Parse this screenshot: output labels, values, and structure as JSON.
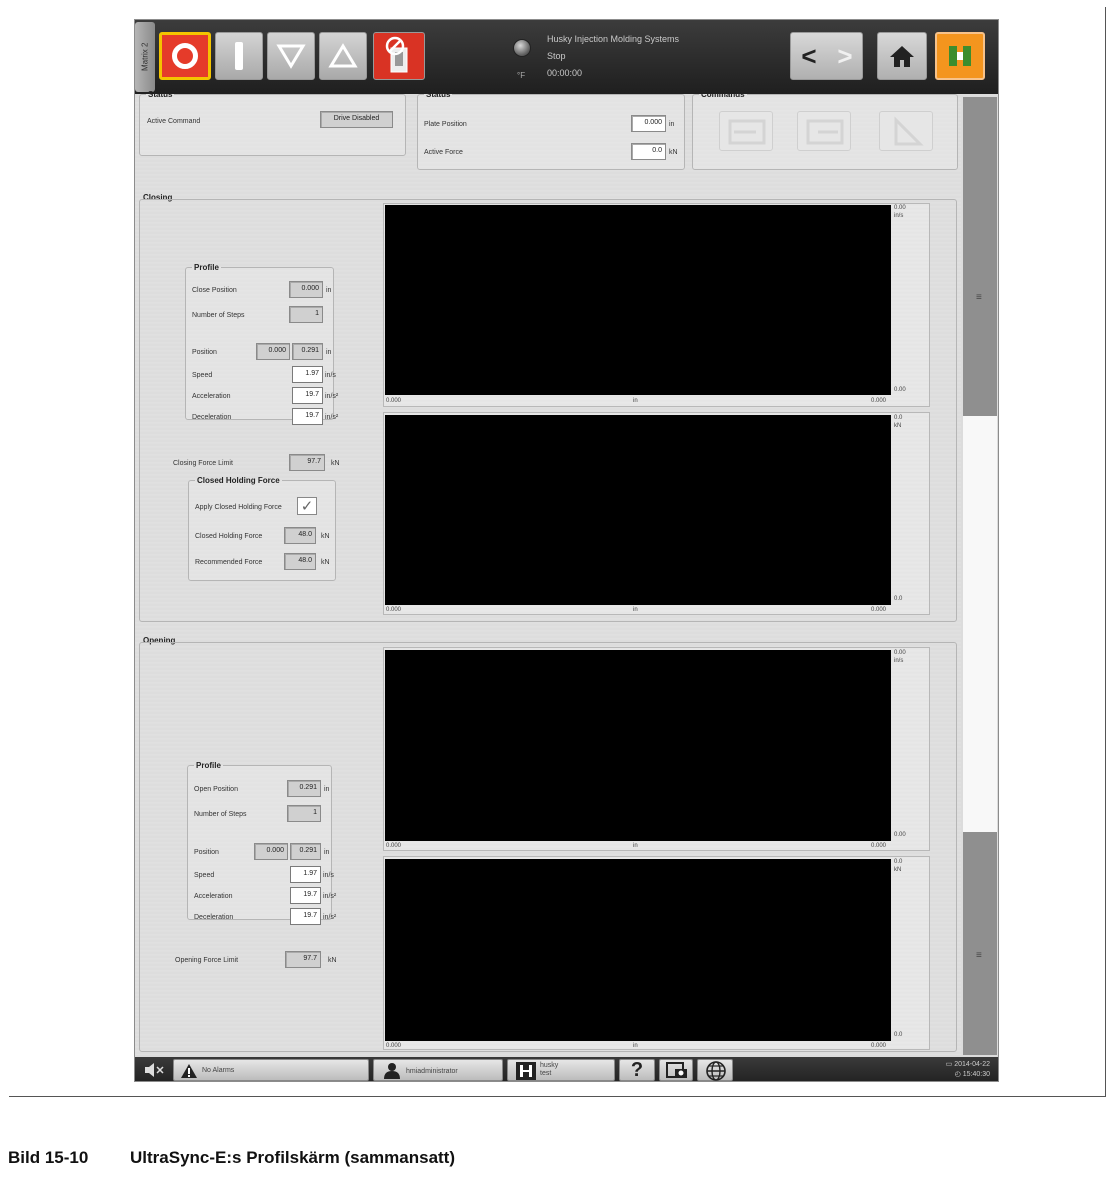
{
  "topbar": {
    "machine_tab": "Matrix 2",
    "temp_unit": "°F",
    "system_name": "Husky Injection Molding Systems",
    "machine_state": "Stop",
    "cycle_time": "00:00:00",
    "nav_back": "<",
    "nav_forward": ">"
  },
  "status_left": {
    "title": "Status",
    "active_command_label": "Active Command",
    "active_command_value": "Drive Disabled"
  },
  "status_right": {
    "title": "Status",
    "plate_position_label": "Plate Position",
    "plate_position_value": "0.000",
    "plate_position_unit": "in",
    "active_force_label": "Active Force",
    "active_force_value": "0.0",
    "active_force_unit": "kN"
  },
  "commands": {
    "title": "Commands"
  },
  "closing": {
    "title": "Closing",
    "profile": {
      "title": "Profile",
      "close_position_label": "Close Position",
      "close_position_value": "0.000",
      "close_position_unit": "in",
      "num_steps_label": "Number of Steps",
      "num_steps_value": "1",
      "position_label": "Position",
      "position_start": "0.000",
      "position_end": "0.291",
      "position_unit": "in",
      "speed_label": "Speed",
      "speed_value": "1.97",
      "speed_unit": "in/s",
      "accel_label": "Acceleration",
      "accel_value": "19.7",
      "accel_unit": "in/s²",
      "decel_label": "Deceleration",
      "decel_value": "19.7",
      "decel_unit": "in/s²"
    },
    "force_limit_label": "Closing Force Limit",
    "force_limit_value": "97.7",
    "force_limit_unit": "kN",
    "holding": {
      "title": "Closed Holding Force",
      "apply_label": "Apply Closed Holding Force",
      "apply_checked": "✓",
      "holding_label": "Closed Holding Force",
      "holding_value": "48.0",
      "holding_unit": "kN",
      "recommended_label": "Recommended Force",
      "recommended_value": "48.0",
      "recommended_unit": "kN"
    },
    "speed_chart": {
      "y_top": "0.00",
      "y_unit": "in/s",
      "y_bottom": "0.00",
      "x_left": "0.000",
      "x_unit": "in",
      "x_right": "0.000"
    },
    "force_chart": {
      "y_top": "0.0",
      "y_unit": "kN",
      "y_bottom": "0.0",
      "x_left": "0.000",
      "x_unit": "in",
      "x_right": "0.000"
    }
  },
  "opening": {
    "title": "Opening",
    "profile": {
      "title": "Profile",
      "open_position_label": "Open Position",
      "open_position_value": "0.291",
      "open_position_unit": "in",
      "num_steps_label": "Number of Steps",
      "num_steps_value": "1",
      "position_label": "Position",
      "position_start": "0.000",
      "position_end": "0.291",
      "position_unit": "in",
      "speed_label": "Speed",
      "speed_value": "1.97",
      "speed_unit": "in/s",
      "accel_label": "Acceleration",
      "accel_value": "19.7",
      "accel_unit": "in/s²",
      "decel_label": "Deceleration",
      "decel_value": "19.7",
      "decel_unit": "in/s²"
    },
    "force_limit_label": "Opening Force Limit",
    "force_limit_value": "97.7",
    "force_limit_unit": "kN",
    "speed_chart": {
      "y_top": "0.00",
      "y_unit": "in/s",
      "y_bottom": "0.00",
      "x_left": "0.000",
      "x_unit": "in",
      "x_right": "0.000"
    },
    "force_chart": {
      "y_top": "0.0",
      "y_unit": "kN",
      "y_bottom": "0.0",
      "x_left": "0.000",
      "x_unit": "in",
      "x_right": "0.000"
    }
  },
  "bottombar": {
    "alarms": "No Alarms",
    "user": "hmiadministrator",
    "mold_line1": "husky",
    "mold_line2": "test",
    "help": "?",
    "date": "2014-04-22",
    "time": "15:40:30"
  },
  "caption": {
    "number": "Bild 15-10",
    "text": "UltraSync-E:s Profilskärm (sammansatt)"
  },
  "colors": {
    "stop_red": "#e53b2a",
    "stop_border": "#f4c400",
    "mold_orange": "#f4951e",
    "plot_bg": "#000000"
  }
}
